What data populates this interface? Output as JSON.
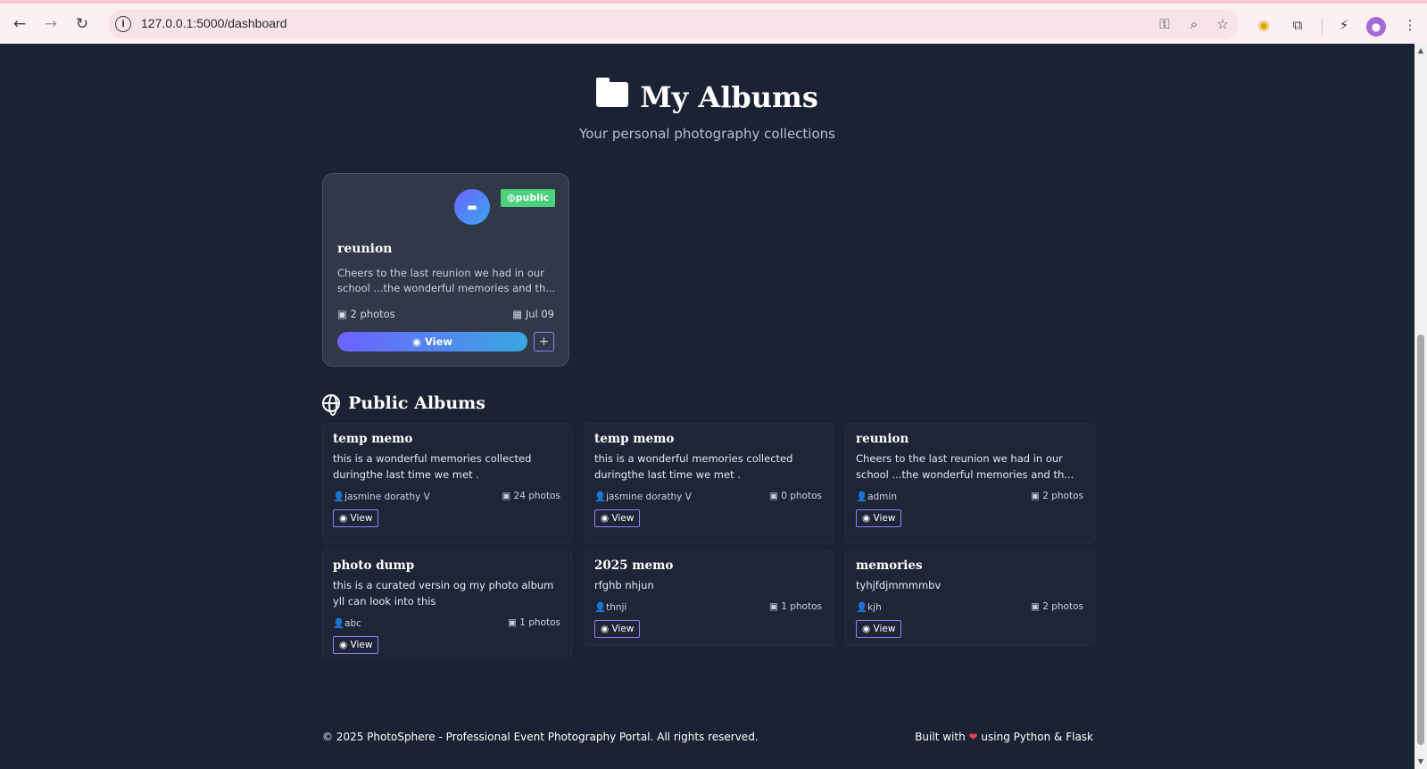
{
  "browser": {
    "url": "127.0.0.1:5000/dashboard",
    "back_icon": "←",
    "forward_icon": "→",
    "reload_icon": "↻"
  },
  "header": {
    "title": "My Albums",
    "subtitle": "Your personal photography collections"
  },
  "my_albums": [
    {
      "name": "reunion",
      "visibility": "public",
      "description": "Cheers to the last reunion we had in our school ...the wonderful memories and th...",
      "photos": "2 photos",
      "date": "Jul 09",
      "view_label": "View",
      "add_label": "+"
    }
  ],
  "public_section": {
    "title": "Public Albums"
  },
  "public_albums": [
    {
      "name": "temp memo",
      "description": "this is a wonderful memories collected duringthe last time we met .",
      "owner": "jasmine dorathy V",
      "photos": "24 photos",
      "view_label": "View"
    },
    {
      "name": "temp memo",
      "description": "this is a wonderful memories collected duringthe last time we met .",
      "owner": "jasmine dorathy V",
      "photos": "0 photos",
      "view_label": "View"
    },
    {
      "name": "reunion",
      "description": "Cheers to the last reunion we had in our school ...the wonderful memories and th...",
      "owner": "admin",
      "photos": "2 photos",
      "view_label": "View"
    },
    {
      "name": "photo dump",
      "description": "this is a curated versin og my photo album yll can look into this",
      "owner": "abc",
      "photos": "1 photos",
      "view_label": "View"
    },
    {
      "name": "2025 memo",
      "description": "rfghb nhjun",
      "owner": "thnji",
      "photos": "1 photos",
      "view_label": "View"
    },
    {
      "name": "memories",
      "description": "tyhjfdjmmmmbv",
      "owner": "kjh",
      "photos": "2 photos",
      "view_label": "View"
    }
  ],
  "footer": {
    "copyright": "© 2025 PhotoSphere - Professional Event Photography Portal. All rights reserved.",
    "built_prefix": "Built with",
    "built_suffix": "using Python & Flask"
  },
  "colors": {
    "background": "#1b2233",
    "accent": "#6c63ff",
    "public_badge": "#4cd07d",
    "heart": "#ef4444"
  }
}
